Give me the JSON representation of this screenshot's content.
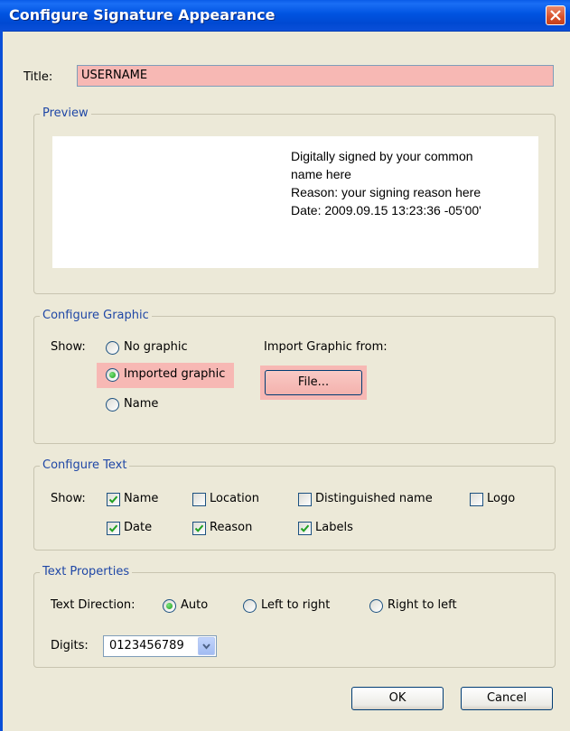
{
  "window": {
    "title": "Configure Signature Appearance"
  },
  "title_field": {
    "label": "Title:",
    "value": "USERNAME"
  },
  "preview": {
    "legend": "Preview",
    "lines": [
      "Digitally signed by your common name here",
      "Reason: your signing reason here",
      "Date: 2009.09.15 13:23:36 -05'00'"
    ]
  },
  "graphic": {
    "legend": "Configure Graphic",
    "show_label": "Show:",
    "options": [
      "No graphic",
      "Imported graphic",
      "Name"
    ],
    "selected": "Imported graphic",
    "import_label": "Import Graphic from:",
    "file_button": "File..."
  },
  "text": {
    "legend": "Configure Text",
    "show_label": "Show:",
    "options": [
      {
        "label": "Name",
        "checked": true
      },
      {
        "label": "Location",
        "checked": false
      },
      {
        "label": "Distinguished name",
        "checked": false
      },
      {
        "label": "Logo",
        "checked": false
      },
      {
        "label": "Date",
        "checked": true
      },
      {
        "label": "Reason",
        "checked": true
      },
      {
        "label": "Labels",
        "checked": true
      }
    ]
  },
  "properties": {
    "legend": "Text Properties",
    "direction_label": "Text Direction:",
    "directions": [
      "Auto",
      "Left to right",
      "Right to left"
    ],
    "selected_direction": "Auto",
    "digits_label": "Digits:",
    "digits_value": "0123456789"
  },
  "buttons": {
    "ok": "OK",
    "cancel": "Cancel"
  },
  "colors": {
    "highlight": "#f7b8b4",
    "legend": "#1f47a6",
    "titlebar": "#0053e1"
  }
}
